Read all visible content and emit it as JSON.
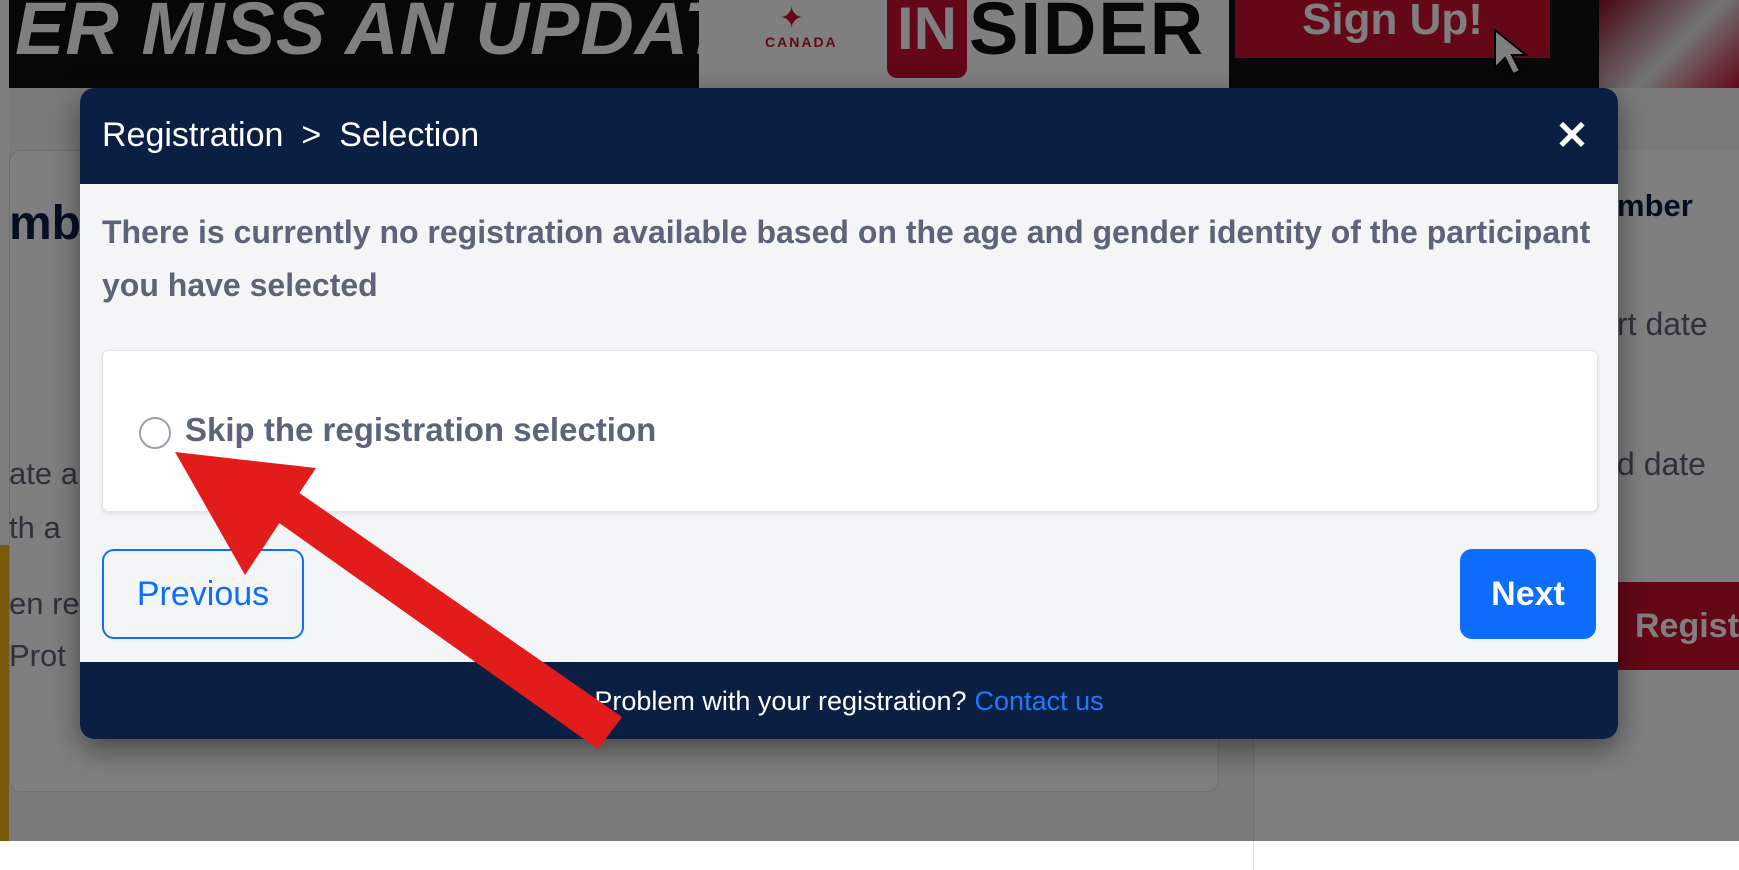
{
  "banner": {
    "slogan": "ER MISS AN UPDATE!",
    "brand_country": "CANADA",
    "brand_in": "IN",
    "brand_rest": "SIDER",
    "cta": "Sign Up!"
  },
  "background": {
    "heading": "mb",
    "lines": [
      "ate a",
      "th a",
      "en re",
      "Prot"
    ],
    "right_header": "mber",
    "right_lines": [
      "rt date",
      "d date"
    ],
    "right_button": "Regist"
  },
  "modal": {
    "breadcrumb": [
      "Registration",
      ">",
      "Selection"
    ],
    "close_symbol": "✕",
    "message": "There is currently no registration available based on the age and gender identity of the participant you have selected",
    "option_label": "Skip the registration selection",
    "option_selected": false,
    "previous_label": "Previous",
    "next_label": "Next",
    "footer_text": "Problem with your registration?",
    "contact_link": "Contact us"
  },
  "colors": {
    "header_navy": "#0b1f43",
    "primary_blue": "#0d6efd",
    "annotation_red": "#e21b1b",
    "brand_red": "#c8102e"
  }
}
